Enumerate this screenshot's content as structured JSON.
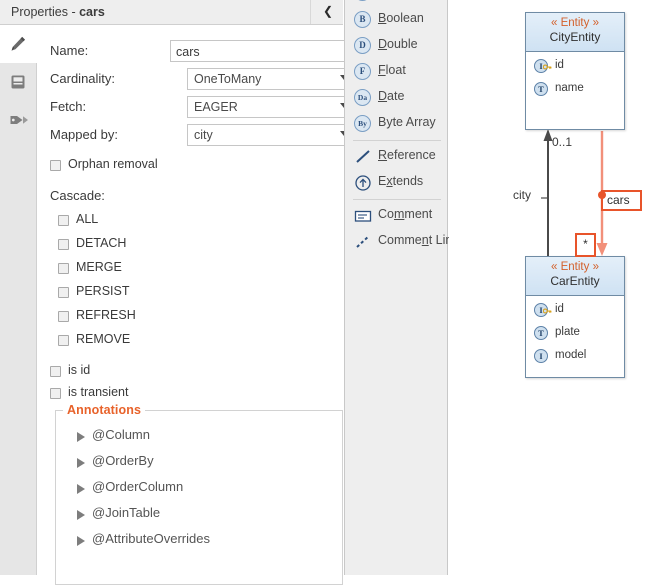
{
  "properties_panel": {
    "title_prefix": "Properties - ",
    "title_target": "cars",
    "collapse_icon": "chevron-left-icon",
    "tabs": [
      {
        "name": "edit-tab",
        "icon": "pencil-icon",
        "selected": true
      },
      {
        "name": "persistence-tab",
        "icon": "book-icon",
        "selected": false
      },
      {
        "name": "annotations-tab",
        "icon": "tag-icon",
        "selected": false
      }
    ],
    "fields": {
      "name": {
        "label": "Name:",
        "value": "cars"
      },
      "cardinality": {
        "label": "Cardinality:",
        "value": "OneToMany"
      },
      "fetch": {
        "label": "Fetch:",
        "value": "EAGER"
      },
      "mapped_by": {
        "label": "Mapped by:",
        "value": "city"
      }
    },
    "orphan_removal": {
      "label": "Orphan removal",
      "checked": false
    },
    "cascade": {
      "label": "Cascade:",
      "options": [
        {
          "label": "ALL",
          "checked": false
        },
        {
          "label": "DETACH",
          "checked": false
        },
        {
          "label": "MERGE",
          "checked": false
        },
        {
          "label": "PERSIST",
          "checked": false
        },
        {
          "label": "REFRESH",
          "checked": false
        },
        {
          "label": "REMOVE",
          "checked": false
        }
      ]
    },
    "is_id": {
      "label": "is id",
      "checked": false
    },
    "is_transient": {
      "label": "is transient",
      "checked": false
    },
    "annotations": {
      "legend": "Annotations",
      "legend_color": "#e8622a",
      "items": [
        {
          "label": "@Column"
        },
        {
          "label": "@OrderBy"
        },
        {
          "label": "@OrderColumn"
        },
        {
          "label": "@JoinTable"
        },
        {
          "label": "@AttributeOverrides"
        }
      ]
    }
  },
  "palette": {
    "items": [
      {
        "label": "Boolean",
        "badge": "B",
        "mnemonic": "B",
        "icon": "boolean-type-icon"
      },
      {
        "label": "Double",
        "badge": "D",
        "mnemonic": "D",
        "icon": "double-type-icon"
      },
      {
        "label": "Float",
        "badge": "F",
        "mnemonic": "F",
        "icon": "float-type-icon"
      },
      {
        "label": "Date",
        "badge": "Da",
        "mnemonic": "D",
        "icon": "date-type-icon"
      },
      {
        "label": "Byte Array",
        "badge": "By",
        "mnemonic": "",
        "icon": "byte-array-type-icon"
      },
      {
        "label": "Reference",
        "badge": "",
        "mnemonic": "R",
        "icon": "reference-icon"
      },
      {
        "label": "Extends",
        "badge": "",
        "mnemonic": "x",
        "icon": "extends-icon"
      },
      {
        "label": "Comment",
        "badge": "",
        "mnemonic": "m",
        "icon": "comment-icon"
      },
      {
        "label": "Comment Link",
        "badge": "",
        "mnemonic": "n",
        "icon": "comment-link-icon"
      }
    ]
  },
  "diagram": {
    "entities": [
      {
        "stereotype": "« Entity »",
        "name": "CityEntity",
        "attributes": [
          {
            "name": "id",
            "badge": "I",
            "key": true
          },
          {
            "name": "name",
            "badge": "T",
            "key": false
          }
        ]
      },
      {
        "stereotype": "« Entity »",
        "name": "CarEntity",
        "attributes": [
          {
            "name": "id",
            "badge": "I",
            "key": true
          },
          {
            "name": "plate",
            "badge": "T",
            "key": false
          },
          {
            "name": "model",
            "badge": "I",
            "key": false
          }
        ]
      }
    ],
    "edge_labels": {
      "source_multiplicity": "0..1",
      "source_role": "city",
      "target_role": "cars",
      "target_multiplicity": "*"
    },
    "selection_color": "#e8542a"
  }
}
